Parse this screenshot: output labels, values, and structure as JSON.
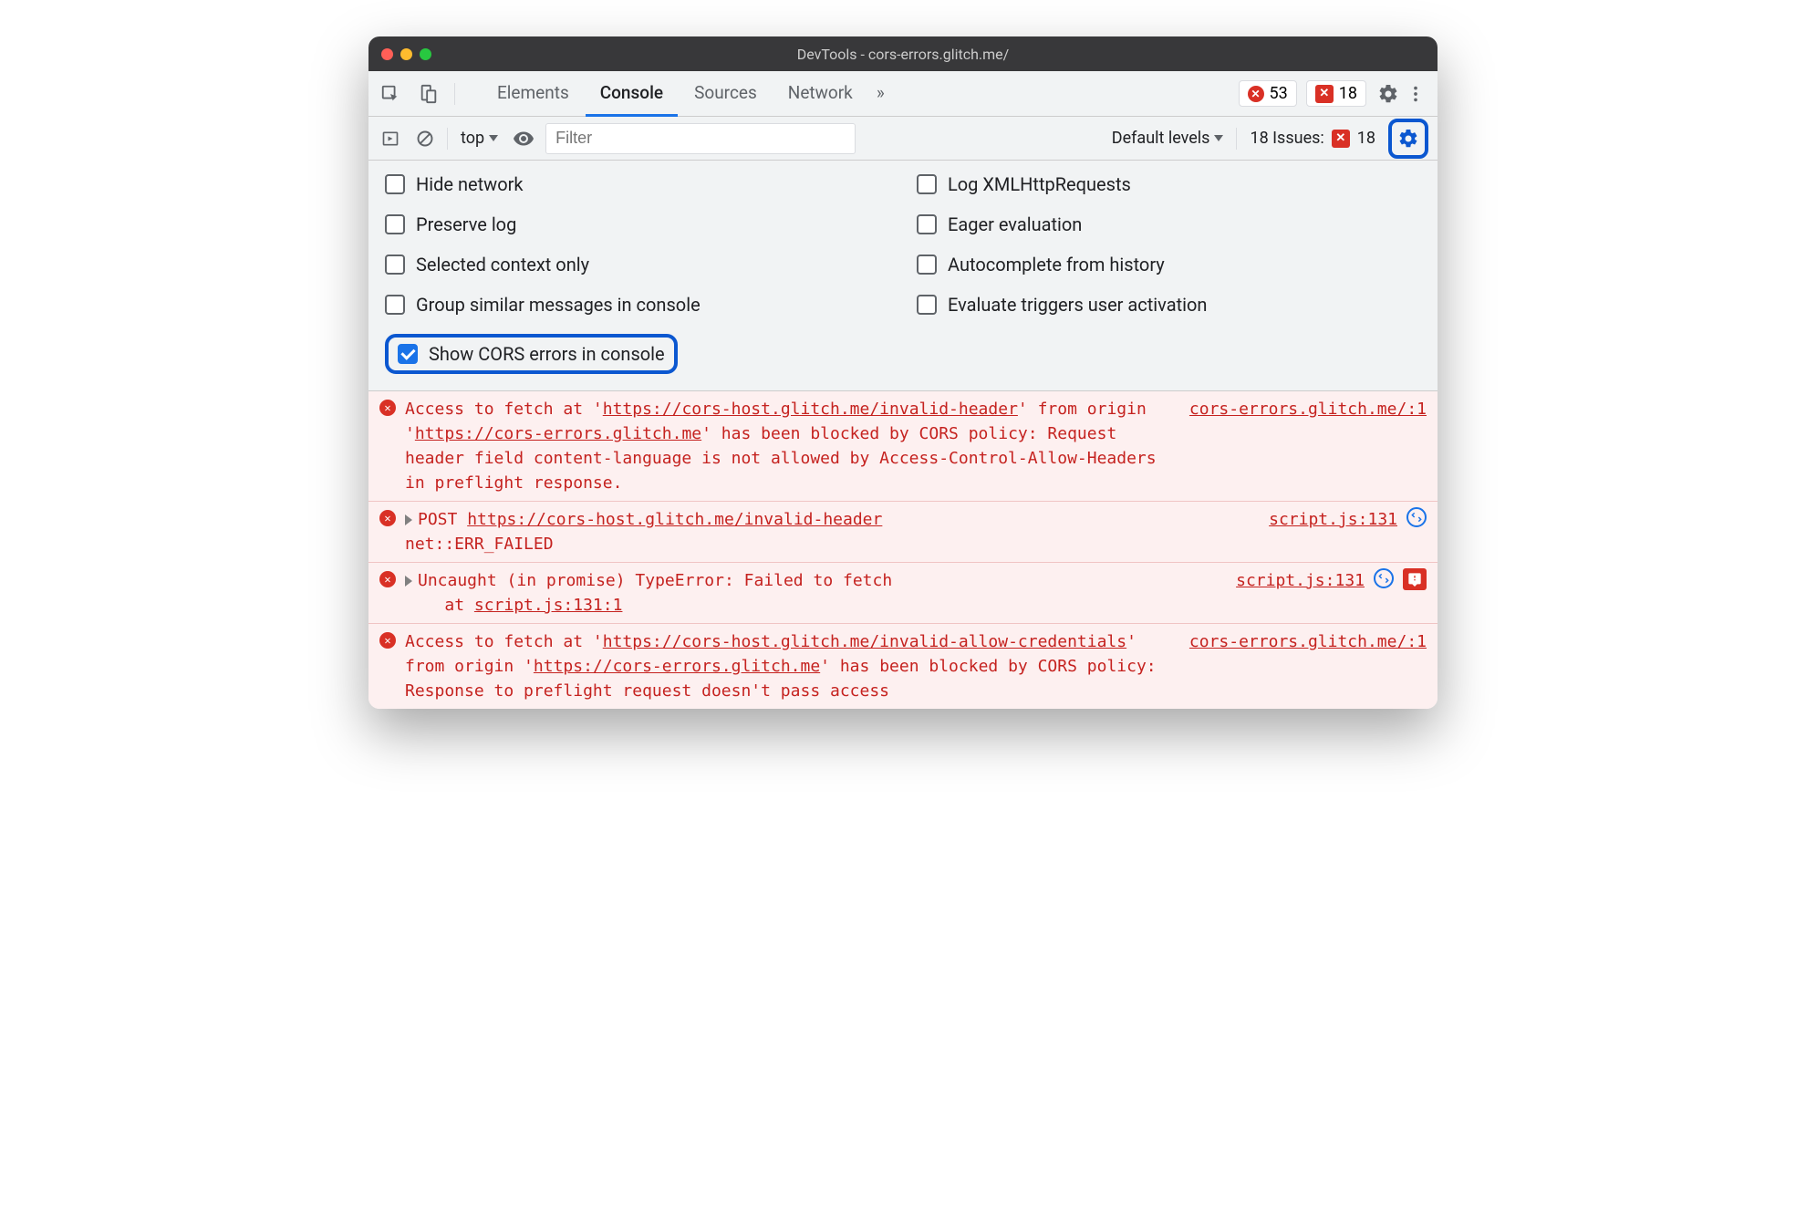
{
  "window": {
    "title": "DevTools - cors-errors.glitch.me/"
  },
  "tabs": {
    "items": [
      "Elements",
      "Console",
      "Sources",
      "Network"
    ],
    "active": "Console",
    "more_icon": "»"
  },
  "counters": {
    "errors": "53",
    "issues": "18"
  },
  "toolbar": {
    "context": "top",
    "filter_placeholder": "Filter",
    "levels": "Default levels",
    "issues_label": "18 Issues:",
    "issues_count": "18"
  },
  "settings": {
    "hide_network": "Hide network",
    "log_xhr": "Log XMLHttpRequests",
    "preserve_log": "Preserve log",
    "eager_eval": "Eager evaluation",
    "selected_context": "Selected context only",
    "autocomplete_history": "Autocomplete from history",
    "group_similar": "Group similar messages in console",
    "eval_triggers": "Evaluate triggers user activation",
    "show_cors": "Show CORS errors in console"
  },
  "logs": [
    {
      "type": "error",
      "body_prefix": "Access to fetch at '",
      "url1": "https://cors-host.glitch.me/invalid-header",
      "mid1": "' from origin '",
      "url2": "https://cors-errors.glitch.me",
      "suffix": "' has been blocked by CORS policy: Request header field content-language is not allowed by Access-Control-Allow-Headers in preflight response.",
      "source": "cors-errors.glitch.me/:1"
    },
    {
      "type": "error-net",
      "method": "POST",
      "url": "https://cors-host.glitch.me/invalid-header",
      "status": "net::ERR_FAILED",
      "source": "script.js:131"
    },
    {
      "type": "error-exc",
      "msg": "Uncaught (in promise) TypeError: Failed to fetch",
      "trace_at": "at ",
      "trace_loc": "script.js:131:1",
      "source": "script.js:131"
    },
    {
      "type": "error",
      "body_prefix": "Access to fetch at '",
      "url1": "https://cors-host.glitch.me/invalid-allow-credentials",
      "mid1": "' from origin '",
      "url2": "https://cors-errors.glitch.me",
      "suffix": "' has been blocked by CORS policy: Response to preflight request doesn't pass access",
      "source": "cors-errors.glitch.me/:1"
    }
  ]
}
